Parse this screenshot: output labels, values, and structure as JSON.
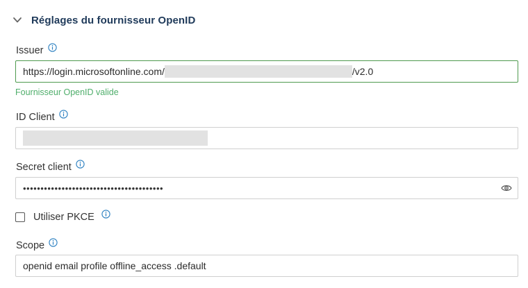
{
  "section": {
    "title": "Réglages du fournisseur OpenID",
    "chevron_icon": "chevron-down-icon"
  },
  "issuer": {
    "label": "Issuer",
    "value_prefix": "https://login.microsoftonline.com/",
    "value_suffix": "/v2.0",
    "status": "Fournisseur OpenID valide",
    "status_color": "#4fae6b",
    "border_color": "#4e9a4e"
  },
  "client_id": {
    "label": "ID Client"
  },
  "client_secret": {
    "label": "Secret client",
    "masked_value": "••••••••••••••••••••••••••••••••••••••••",
    "toggle_icon": "eye-icon"
  },
  "pkce": {
    "label": "Utiliser PKCE",
    "checked": false
  },
  "scope": {
    "label": "Scope",
    "value": "openid email profile offline_access .default"
  },
  "colors": {
    "title": "#1f3a5a",
    "info_icon": "#2a7fc0"
  }
}
